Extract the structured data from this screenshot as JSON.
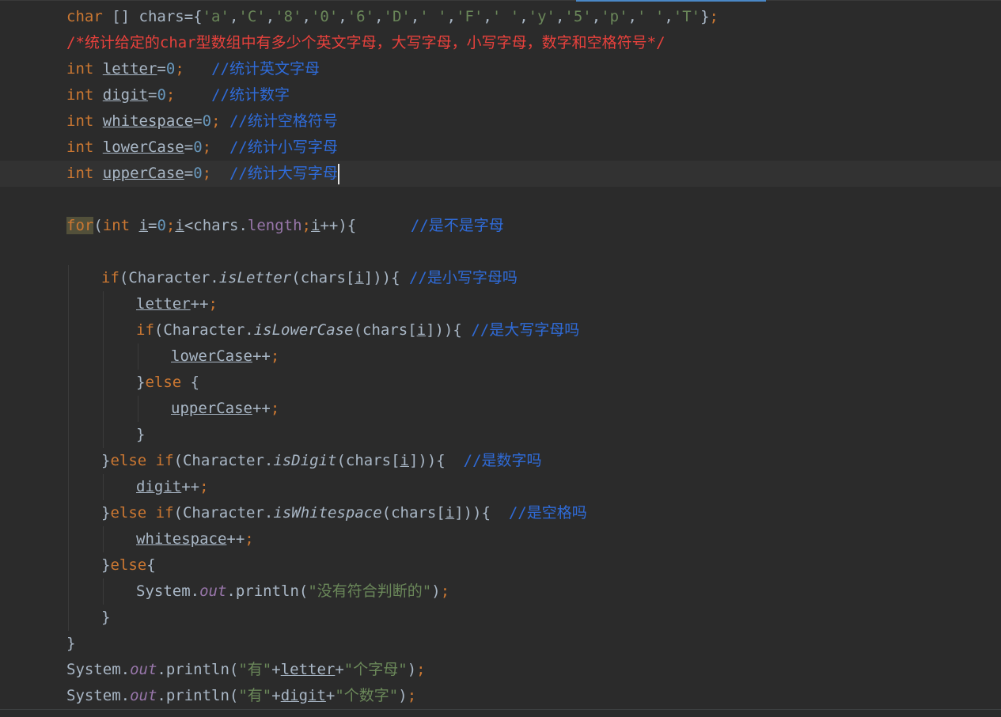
{
  "editor": {
    "lines": [
      {
        "tokens": [
          {
            "t": "char",
            "c": "kw"
          },
          {
            "t": " [] chars="
          },
          {
            "t": "{",
            "c": "plain"
          },
          {
            "t": "'a'",
            "c": "str"
          },
          {
            "t": ","
          },
          {
            "t": "'C'",
            "c": "str"
          },
          {
            "t": ","
          },
          {
            "t": "'8'",
            "c": "str"
          },
          {
            "t": ","
          },
          {
            "t": "'0'",
            "c": "str"
          },
          {
            "t": ","
          },
          {
            "t": "'6'",
            "c": "str"
          },
          {
            "t": ","
          },
          {
            "t": "'D'",
            "c": "str"
          },
          {
            "t": ","
          },
          {
            "t": "' '",
            "c": "str"
          },
          {
            "t": ","
          },
          {
            "t": "'F'",
            "c": "str"
          },
          {
            "t": ","
          },
          {
            "t": "' '",
            "c": "str"
          },
          {
            "t": ","
          },
          {
            "t": "'y'",
            "c": "str"
          },
          {
            "t": ","
          },
          {
            "t": "'5'",
            "c": "str"
          },
          {
            "t": ","
          },
          {
            "t": "'p'",
            "c": "str"
          },
          {
            "t": ","
          },
          {
            "t": "' '",
            "c": "str"
          },
          {
            "t": ","
          },
          {
            "t": "'T'",
            "c": "str"
          },
          {
            "t": "}"
          },
          {
            "t": ";",
            "c": "kw"
          }
        ]
      },
      {
        "tokens": [
          {
            "t": "/*统计给定的char型数组中有多少个英文字母，大写字母，小写字母，数字和空格符号*/",
            "c": "cmt-red"
          }
        ]
      },
      {
        "tokens": [
          {
            "t": "int",
            "c": "kw"
          },
          {
            "t": " "
          },
          {
            "t": "letter",
            "c": "var"
          },
          {
            "t": "="
          },
          {
            "t": "0",
            "c": "num"
          },
          {
            "t": ";",
            "c": "kw"
          },
          {
            "t": "   "
          },
          {
            "t": "//统计英文字母",
            "c": "cmt-blue"
          }
        ]
      },
      {
        "tokens": [
          {
            "t": "int",
            "c": "kw"
          },
          {
            "t": " "
          },
          {
            "t": "digit",
            "c": "var"
          },
          {
            "t": "="
          },
          {
            "t": "0",
            "c": "num"
          },
          {
            "t": ";",
            "c": "kw"
          },
          {
            "t": "    "
          },
          {
            "t": "//统计数字",
            "c": "cmt-blue"
          }
        ]
      },
      {
        "tokens": [
          {
            "t": "int",
            "c": "kw"
          },
          {
            "t": " "
          },
          {
            "t": "whitespace",
            "c": "var"
          },
          {
            "t": "="
          },
          {
            "t": "0",
            "c": "num"
          },
          {
            "t": ";",
            "c": "kw"
          },
          {
            "t": " "
          },
          {
            "t": "//统计空格符号",
            "c": "cmt-blue"
          }
        ]
      },
      {
        "tokens": [
          {
            "t": "int",
            "c": "kw"
          },
          {
            "t": " "
          },
          {
            "t": "lowerCase",
            "c": "var"
          },
          {
            "t": "="
          },
          {
            "t": "0",
            "c": "num"
          },
          {
            "t": ";",
            "c": "kw"
          },
          {
            "t": "  "
          },
          {
            "t": "//统计小写字母",
            "c": "cmt-blue"
          }
        ]
      },
      {
        "current": true,
        "caret": true,
        "tokens": [
          {
            "t": "int",
            "c": "kw"
          },
          {
            "t": " "
          },
          {
            "t": "upperCase",
            "c": "var"
          },
          {
            "t": "="
          },
          {
            "t": "0",
            "c": "num"
          },
          {
            "t": ";",
            "c": "kw"
          },
          {
            "t": "  "
          },
          {
            "t": "//统计大写字母",
            "c": "cmt-blue"
          }
        ]
      },
      {
        "tokens": []
      },
      {
        "tokens": [
          {
            "t": "for",
            "c": "kw hl"
          },
          {
            "t": "("
          },
          {
            "t": "int",
            "c": "kw"
          },
          {
            "t": " "
          },
          {
            "t": "i",
            "c": "var"
          },
          {
            "t": "="
          },
          {
            "t": "0",
            "c": "num"
          },
          {
            "t": ";",
            "c": "kw"
          },
          {
            "t": "i",
            "c": "var"
          },
          {
            "t": "<chars."
          },
          {
            "t": "length",
            "c": "fld"
          },
          {
            "t": ";",
            "c": "kw"
          },
          {
            "t": "i",
            "c": "var"
          },
          {
            "t": "++){      "
          },
          {
            "t": "//是不是字母",
            "c": "cmt-blue"
          }
        ]
      },
      {
        "tokens": []
      },
      {
        "indent": 1,
        "tokens": [
          {
            "t": "if",
            "c": "kw"
          },
          {
            "t": "(Character."
          },
          {
            "t": "isLetter",
            "c": "mth"
          },
          {
            "t": "(chars["
          },
          {
            "t": "i",
            "c": "var"
          },
          {
            "t": "])){ "
          },
          {
            "t": "//是小写字母吗",
            "c": "cmt-blue"
          }
        ]
      },
      {
        "indent": 2,
        "tokens": [
          {
            "t": "letter",
            "c": "var"
          },
          {
            "t": "++"
          },
          {
            "t": ";",
            "c": "kw"
          }
        ]
      },
      {
        "indent": 2,
        "tokens": [
          {
            "t": "if",
            "c": "kw"
          },
          {
            "t": "(Character."
          },
          {
            "t": "isLowerCase",
            "c": "mth"
          },
          {
            "t": "(chars["
          },
          {
            "t": "i",
            "c": "var"
          },
          {
            "t": "])){ "
          },
          {
            "t": "//是大写字母吗",
            "c": "cmt-blue"
          }
        ]
      },
      {
        "indent": 3,
        "tokens": [
          {
            "t": "lowerCase",
            "c": "var"
          },
          {
            "t": "++"
          },
          {
            "t": ";",
            "c": "kw"
          }
        ]
      },
      {
        "indent": 2,
        "tokens": [
          {
            "t": "}"
          },
          {
            "t": "else",
            "c": "kw"
          },
          {
            "t": " {"
          }
        ]
      },
      {
        "indent": 3,
        "tokens": [
          {
            "t": "upperCase",
            "c": "var"
          },
          {
            "t": "++"
          },
          {
            "t": ";",
            "c": "kw"
          }
        ]
      },
      {
        "indent": 2,
        "tokens": [
          {
            "t": "}"
          }
        ]
      },
      {
        "indent": 1,
        "tokens": [
          {
            "t": "}"
          },
          {
            "t": "else if",
            "c": "kw"
          },
          {
            "t": "(Character."
          },
          {
            "t": "isDigit",
            "c": "mth"
          },
          {
            "t": "(chars["
          },
          {
            "t": "i",
            "c": "var"
          },
          {
            "t": "])){  "
          },
          {
            "t": "//是数字吗",
            "c": "cmt-blue"
          }
        ]
      },
      {
        "indent": 2,
        "tokens": [
          {
            "t": "digit",
            "c": "var"
          },
          {
            "t": "++"
          },
          {
            "t": ";",
            "c": "kw"
          }
        ]
      },
      {
        "indent": 1,
        "tokens": [
          {
            "t": "}"
          },
          {
            "t": "else if",
            "c": "kw"
          },
          {
            "t": "(Character."
          },
          {
            "t": "isWhitespace",
            "c": "mth"
          },
          {
            "t": "(chars["
          },
          {
            "t": "i",
            "c": "var"
          },
          {
            "t": "])){  "
          },
          {
            "t": "//是空格吗",
            "c": "cmt-blue"
          }
        ]
      },
      {
        "indent": 2,
        "tokens": [
          {
            "t": "whitespace",
            "c": "var"
          },
          {
            "t": "++"
          },
          {
            "t": ";",
            "c": "kw"
          }
        ]
      },
      {
        "indent": 1,
        "tokens": [
          {
            "t": "}"
          },
          {
            "t": "else",
            "c": "kw"
          },
          {
            "t": "{"
          }
        ]
      },
      {
        "indent": 2,
        "tokens": [
          {
            "t": "System."
          },
          {
            "t": "out",
            "c": "static"
          },
          {
            "t": ".println("
          },
          {
            "t": "\"没有符合判断的\"",
            "c": "str"
          },
          {
            "t": ")"
          },
          {
            "t": ";",
            "c": "kw"
          }
        ]
      },
      {
        "indent": 1,
        "tokens": [
          {
            "t": "}"
          }
        ]
      },
      {
        "tokens": [
          {
            "t": "}"
          }
        ]
      },
      {
        "tokens": [
          {
            "t": "System."
          },
          {
            "t": "out",
            "c": "static"
          },
          {
            "t": ".println("
          },
          {
            "t": "\"有\"",
            "c": "str"
          },
          {
            "t": "+"
          },
          {
            "t": "letter",
            "c": "var"
          },
          {
            "t": "+"
          },
          {
            "t": "\"个字母\"",
            "c": "str"
          },
          {
            "t": ")"
          },
          {
            "t": ";",
            "c": "kw"
          }
        ]
      },
      {
        "tokens": [
          {
            "t": "System."
          },
          {
            "t": "out",
            "c": "static"
          },
          {
            "t": ".println("
          },
          {
            "t": "\"有\"",
            "c": "str"
          },
          {
            "t": "+"
          },
          {
            "t": "digit",
            "c": "var"
          },
          {
            "t": "+"
          },
          {
            "t": "\"个数字\"",
            "c": "str"
          },
          {
            "t": ")"
          },
          {
            "t": ";",
            "c": "kw"
          }
        ]
      }
    ]
  },
  "colors": {
    "background": "#2b2b2b",
    "keyword": "#cc7832",
    "string": "#6a8759",
    "comment_red": "#e8413c",
    "comment_blue": "#2f6bd8",
    "field": "#9876aa",
    "number": "#6897bb",
    "text": "#a9b7c6"
  }
}
